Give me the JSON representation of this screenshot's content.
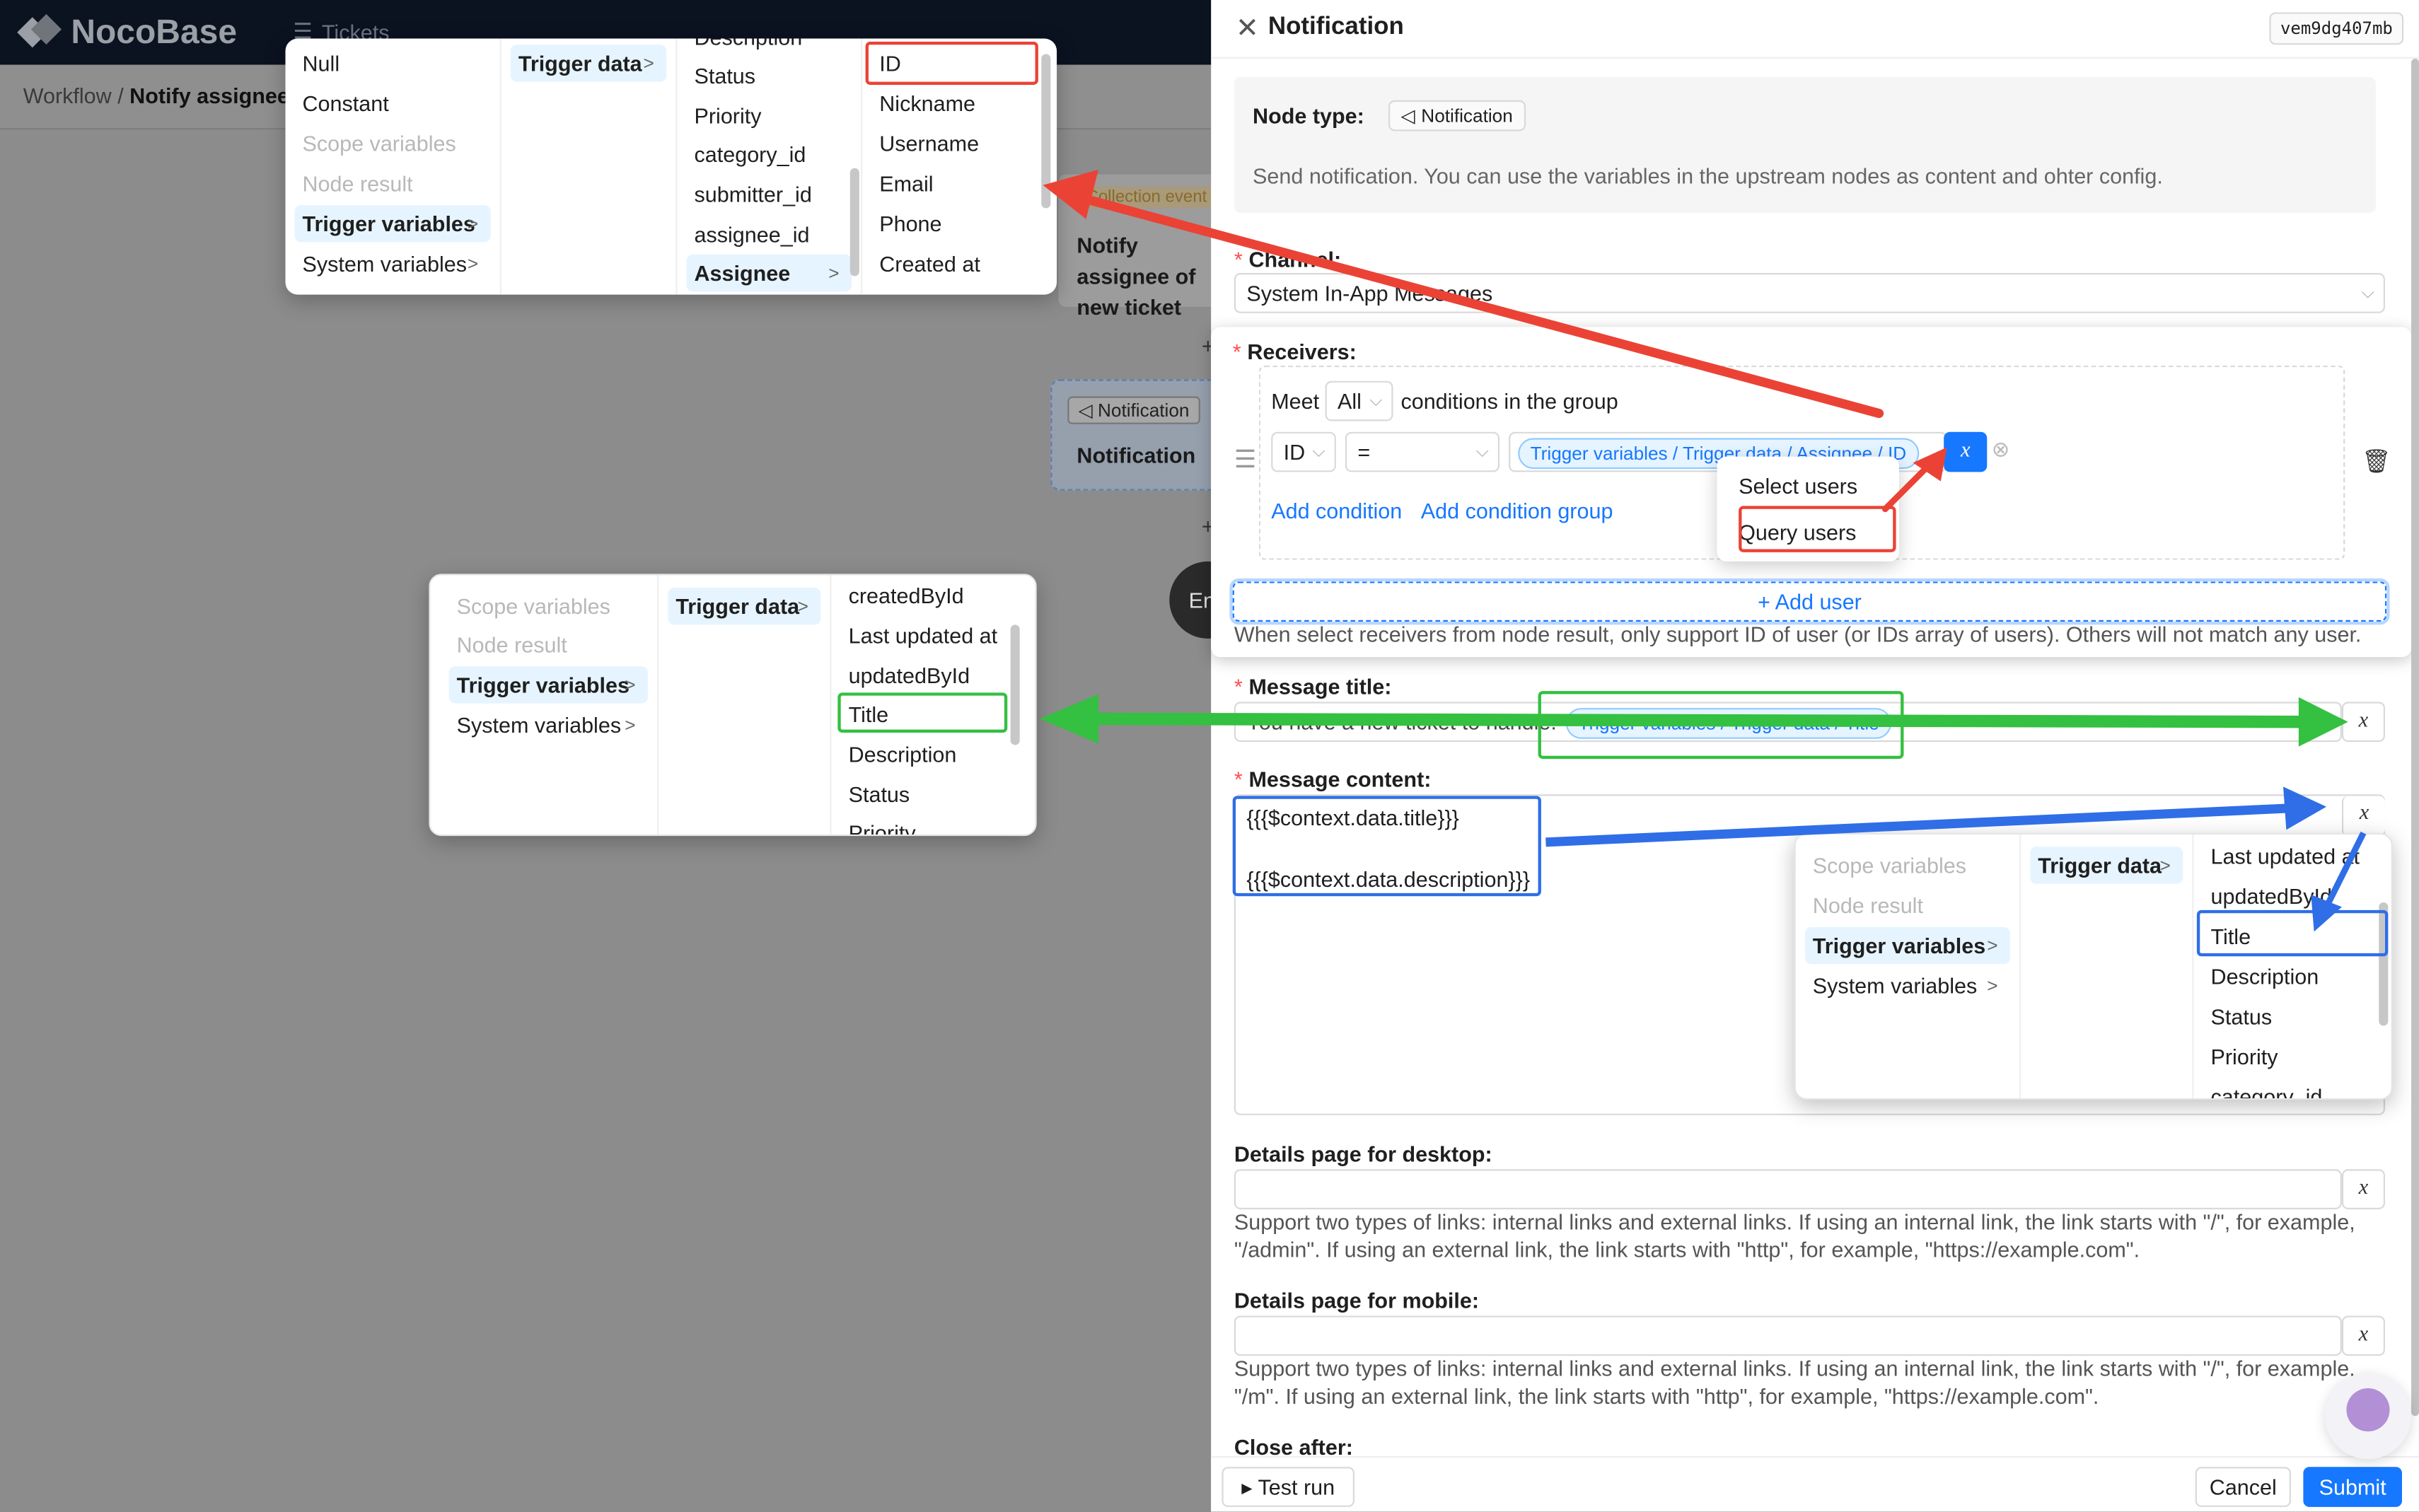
{
  "app": {
    "logo_text": "NocoBase",
    "top_menu_label": "Tickets"
  },
  "breadcrumb": {
    "root": "Workflow",
    "sep": " / ",
    "current": "Notify assignee of new ticket"
  },
  "canvas": {
    "trigger_tag": "Collection event",
    "trigger_title": "Notify assignee of new ticket",
    "notif_tag": "Notification",
    "notif_title": "Notification",
    "end_label": "End"
  },
  "drawer": {
    "title": "Notification",
    "node_id": "vem9dg407mb",
    "node_type_label": "Node type:",
    "node_type_value": "Notification",
    "description": "Send notification. You can use the variables in the upstream nodes as content and ohter config.",
    "channel_label": "Channel:",
    "channel_value": "System In-App Messages",
    "receivers_label": "Receivers:",
    "meet_label": "Meet",
    "meet_value": "All",
    "meet_suffix": "conditions in the group",
    "cond_field": "ID",
    "cond_op": "=",
    "cond_value": "Trigger variables / Trigger data / Assignee / ID",
    "add_condition": "Add condition",
    "add_condition_group": "Add condition group",
    "user_menu": [
      "Select users",
      "Query users"
    ],
    "add_user": "Add user",
    "receivers_hint": "When select receivers from node result, only support ID of user (or IDs array of users). Others will not match any user.",
    "title_label": "Message title:",
    "title_prefix": "You have a new ticket to handle:",
    "title_var": "Trigger variables / Trigger data / Title",
    "content_label": "Message content:",
    "content_line1": "{{{$context.data.title}}}",
    "content_line2": "{{{$context.data.description}}}",
    "desktop_label": "Details page for desktop:",
    "desktop_hint": "Support two types of links: internal links and external links. If using an internal link, the link starts with \"/\", for example, \"/admin\". If using an external link, the link starts with \"http\", for example, \"https://example.com\".",
    "mobile_label": "Details page for mobile:",
    "mobile_hint": "Support two types of links: internal links and external links. If using an internal link, the link starts with \"/\", for example, \"/m\". If using an external link, the link starts with \"http\", for example, \"https://example.com\".",
    "close_after_label": "Close after:",
    "test_run": "Test run",
    "cancel": "Cancel",
    "submit": "Submit"
  },
  "popover_top": {
    "col1": [
      "Null",
      "Constant",
      "Scope variables",
      "Node result",
      "Trigger variables",
      "System variables"
    ],
    "col2": [
      "Trigger data"
    ],
    "col3": [
      "Description",
      "Status",
      "Priority",
      "category_id",
      "submitter_id",
      "assignee_id",
      "Assignee"
    ],
    "col4": [
      "ID",
      "Nickname",
      "Username",
      "Email",
      "Phone",
      "Created at"
    ]
  },
  "popover_mid": {
    "col1": [
      "Scope variables",
      "Node result",
      "Trigger variables",
      "System variables"
    ],
    "col2": [
      "Trigger data"
    ],
    "col3": [
      "createdById",
      "Last updated at",
      "updatedById",
      "Title",
      "Description",
      "Status",
      "Priority"
    ]
  },
  "popover_content": {
    "col1": [
      "Scope variables",
      "Node result",
      "Trigger variables",
      "System variables"
    ],
    "col2": [
      "Trigger data"
    ],
    "col3": [
      "Last updated at",
      "updatedById",
      "Title",
      "Description",
      "Status",
      "Priority",
      "category_id"
    ]
  },
  "colors": {
    "red": "#ea4335",
    "green": "#34c040",
    "blue": "#2f6ee6",
    "primary": "#1677ff"
  }
}
